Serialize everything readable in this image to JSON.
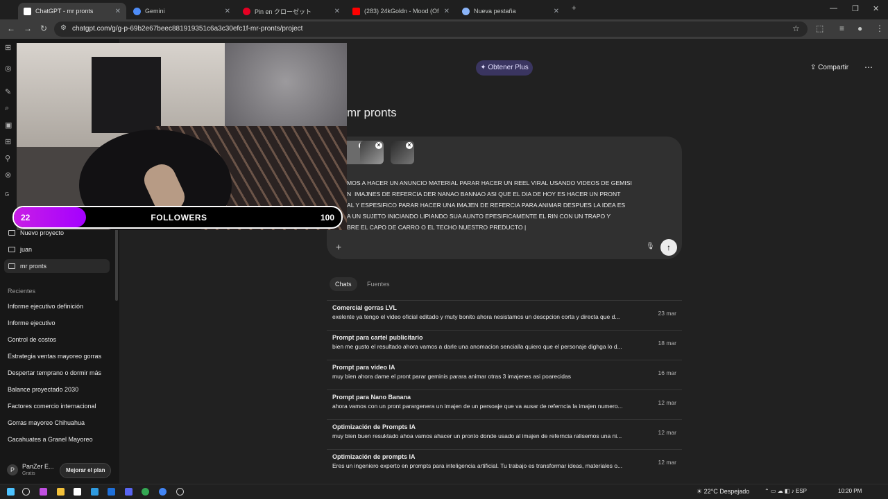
{
  "browser": {
    "tabs": [
      {
        "label": "ChatGPT - mr pronts",
        "active": true,
        "color": "#ffffff"
      },
      {
        "label": "Gemini",
        "active": false,
        "color": "#4e8cf7"
      },
      {
        "label": "Pin en クローゼット",
        "active": false,
        "color": "#e60023"
      },
      {
        "label": "(283) 24kGoldn - Mood (Of",
        "active": false,
        "color": "#ff0000"
      },
      {
        "label": "Nueva pestaña",
        "active": false,
        "color": "#8ab4f8"
      }
    ],
    "new_tab": "+",
    "url": "chatgpt.com/g/g-p-69b2e67beec881919351c6a3c30efc1f-mr-pronts/project"
  },
  "sidebar": {
    "projects": [
      {
        "label": "Nuevo proyecto",
        "selected": false
      },
      {
        "label": "juan",
        "selected": false
      },
      {
        "label": "mr pronts",
        "selected": true
      }
    ],
    "recents_heading": "Recientes",
    "recents": [
      "Informe ejecutivo definición",
      "Informe ejecutivo",
      "Control de costos",
      "Estrategia ventas mayoreo gorras",
      "Despertar temprano o dormir más",
      "Balance proyectado 2030",
      "Factores comercio internacional",
      "Gorras mayoreo Chihuahua",
      "Cacahuates a Granel Mayoreo"
    ],
    "user": {
      "name": "PanZer E...",
      "plan": "Gratis",
      "upgrade": "Mejorar el plan"
    }
  },
  "main": {
    "plus_button": "Obtener Plus",
    "share": "Compartir",
    "title": "mr pronts",
    "prompt_text": "MOS A HACER UN ANUNCIO MATERIAL PARAR HACER UN REEL VIRAL USANDO VIDEOS DE GEMISI\nN  IMAJNES DE REFERCIA DER NANAO BANNAO ASI QUE EL DIA DE HOY ES HACER UN PRONT\nAL Y ESPESIFICO PARAR HACER UNA IMAJEN DE REFERCIA PARA ANIMAR DESPUES LA IDEA ES\nA UN SUJETO INICIANDO LIPIANDO SUA AUNTO EPESIFICAMENTE EL RIN CON UN TRAPO Y\nBRE EL CAPO DE CARRO O EL TECHO NUESTRO PREDUCTO |",
    "subtabs": [
      "Chats",
      "Fuentes"
    ],
    "chats": [
      {
        "title": "Comercial gorras LVL",
        "preview": "exelente ya tengo el video oficial editado y muty bonito ahora nesistamos un descpcion corta y directa que d...",
        "date": "23 mar"
      },
      {
        "title": "Prompt para cartel publicitario",
        "preview": "bien me gusto el resultado ahora vamos a darle una anomacion sencialla quiero que el personaje dighga lo d...",
        "date": "18 mar"
      },
      {
        "title": "Prompt para video IA",
        "preview": "muy bien ahora dame el pront parar geminis parara animar otras 3 imajenes asi poarecidas",
        "date": "16 mar"
      },
      {
        "title": "Prompt para Nano Banana",
        "preview": "ahora vamos con un pront parargenera un imajen de un persoaje que va ausar de referncia la imajen numero...",
        "date": "12 mar"
      },
      {
        "title": "Optimización de Prompts IA",
        "preview": "muy bien buen resuktado ahoa vamos ahacer un pronto donde usado al imajen de referncia ralisemos una ni...",
        "date": "12 mar"
      },
      {
        "title": "Optimización de prompts IA",
        "preview": "Eres un ingeniero experto en prompts para inteligencia artificial. Tu trabajo es transformar ideas, materiales o...",
        "date": "12 mar"
      }
    ]
  },
  "overlay": {
    "followers_current": "22",
    "followers_label": "FOLLOWERS",
    "followers_goal": "100",
    "progress_fraction": 0.22
  },
  "taskbar": {
    "weather": "22°C  Despejado",
    "tray": "ESP",
    "time": "10:20 PM"
  }
}
